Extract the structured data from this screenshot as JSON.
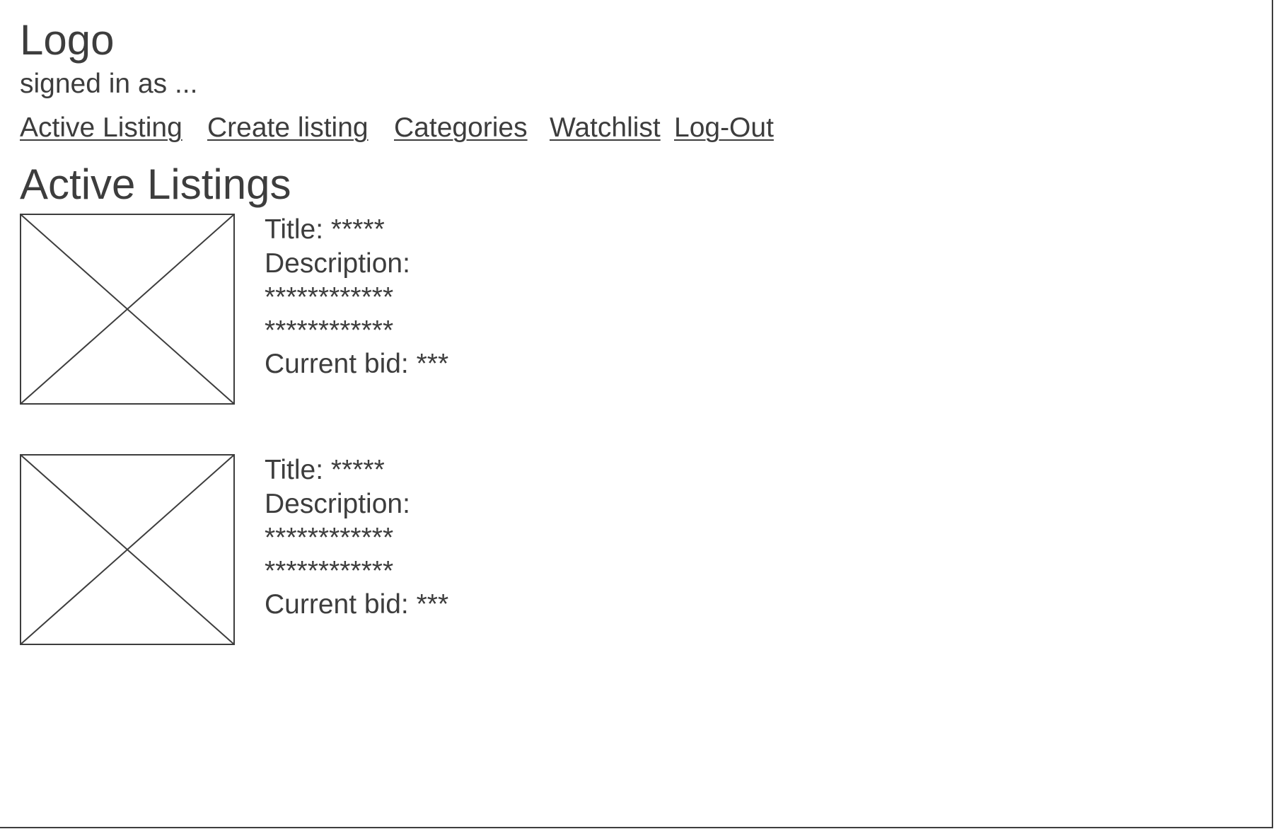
{
  "header": {
    "logo": "Logo",
    "signed_in": "signed in as ..."
  },
  "nav": {
    "items": [
      {
        "label": "Active Listing"
      },
      {
        "label": "Create listing"
      },
      {
        "label": "Categories"
      },
      {
        "label": "Watchlist"
      },
      {
        "label": "Log-Out"
      }
    ]
  },
  "main": {
    "title": "Active Listings",
    "listings": [
      {
        "title": "Title: *****",
        "description_label": "Description:",
        "description_lines": [
          "************",
          "************"
        ],
        "current_bid": "Current bid: ***"
      },
      {
        "title": "Title: *****",
        "description_label": "Description:",
        "description_lines": [
          "************",
          "************"
        ],
        "current_bid": "Current bid: ***"
      }
    ]
  },
  "colors": {
    "ink": "#3d3d3d",
    "background": "#ffffff"
  },
  "icons": {
    "image_placeholder": "image-placeholder-icon"
  }
}
